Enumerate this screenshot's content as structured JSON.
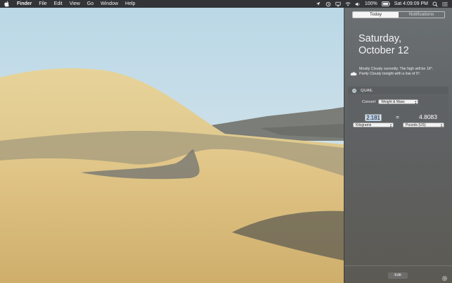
{
  "menubar": {
    "app_name": "Finder",
    "menus": [
      "File",
      "Edit",
      "View",
      "Go",
      "Window",
      "Help"
    ],
    "battery": "100%",
    "clock": "Sat 4:09:09 PM",
    "status_icons": [
      "location-arrow-icon",
      "time-machine-icon",
      "airplay-icon",
      "wifi-icon",
      "volume-icon",
      "battery-icon",
      "spotlight-search-icon",
      "notification-center-icon"
    ]
  },
  "notification_center": {
    "tabs": [
      "Today",
      "Notifications"
    ],
    "selected_tab": "Today",
    "date_line1": "Saturday,",
    "date_line2": "October 12",
    "weather_line1": "Mostly Cloudy currently. The high will be 16°.",
    "weather_line2": "Partly Cloudy tonight with a low of 5°.",
    "quail": {
      "title": "QUAIL",
      "convert_label": "Convert",
      "convert_option": "Weight & Mass",
      "input_value": "2.181",
      "equals": "=",
      "result_value": "4.8083",
      "from_unit": "Kilograms",
      "to_unit": "Pounds (US)"
    },
    "edit_label": "Edit"
  },
  "colors": {
    "menubar_bg": "#262628",
    "panel_bg": "#62666a",
    "selection": "#b8cde6"
  }
}
